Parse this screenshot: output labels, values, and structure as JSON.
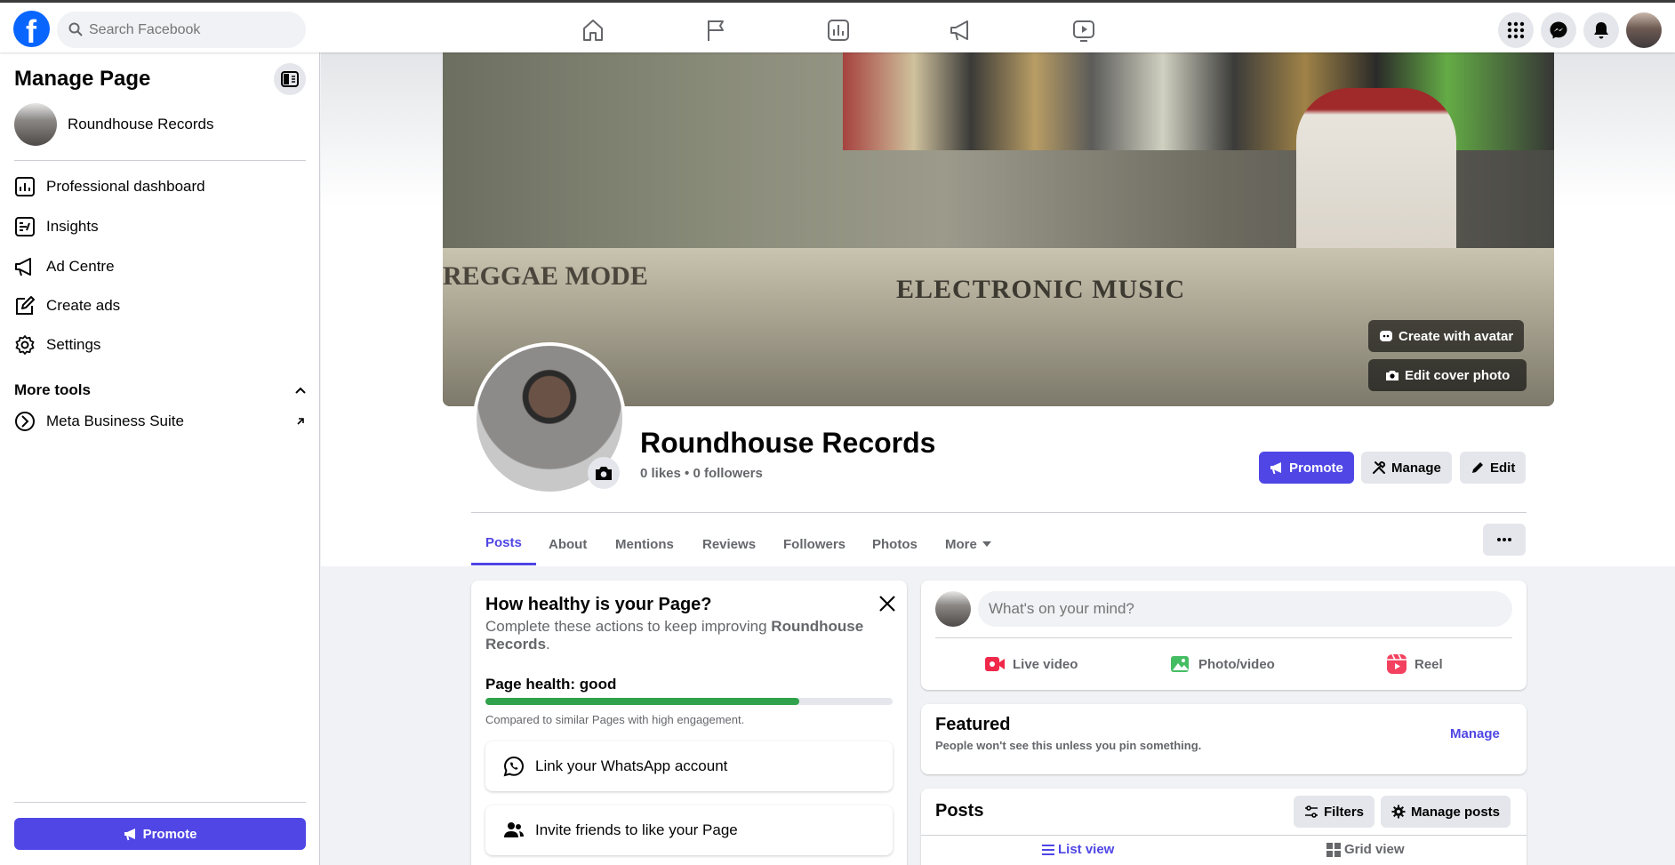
{
  "topbar": {
    "logo": "f",
    "search_placeholder": "Search Facebook",
    "nav_icons": [
      "home-icon",
      "flag-icon",
      "insights-icon",
      "megaphone-icon",
      "video-icon"
    ],
    "right_icons": [
      "menu-grid-icon",
      "messenger-icon",
      "bell-icon"
    ]
  },
  "sidebar": {
    "title": "Manage Page",
    "page_name": "Roundhouse Records",
    "items": [
      {
        "label": "Professional dashboard",
        "icon": "dashboard-icon"
      },
      {
        "label": "Insights",
        "icon": "insights-icon"
      },
      {
        "label": "Ad Centre",
        "icon": "megaphone-icon"
      },
      {
        "label": "Create ads",
        "icon": "edit-icon"
      },
      {
        "label": "Settings",
        "icon": "gear-icon"
      }
    ],
    "more_tools_label": "More tools",
    "tools": [
      {
        "label": "Meta Business Suite",
        "icon": "meta-icon"
      }
    ],
    "promote_label": "Promote"
  },
  "cover": {
    "create_avatar_label": "Create with avatar",
    "edit_cover_label": "Edit cover photo",
    "bin_label_1": "ELECTRONIC MUSIC",
    "bin_label_2": "REGGAE MODE"
  },
  "profile": {
    "name": "Roundhouse Records",
    "stats": "0 likes • 0 followers",
    "promote_label": "Promote",
    "manage_label": "Manage",
    "edit_label": "Edit"
  },
  "tabs": [
    "Posts",
    "About",
    "Mentions",
    "Reviews",
    "Followers",
    "Photos",
    "More"
  ],
  "health": {
    "title": "How healthy is your Page?",
    "desc_prefix": "Complete these actions to keep improving ",
    "desc_page": "Roundhouse Records",
    "desc_suffix": ".",
    "status": "Page health: good",
    "progress": 0.77,
    "note": "Compared to similar Pages with high engagement.",
    "actions": [
      "Link your WhatsApp account",
      "Invite friends to like your Page"
    ]
  },
  "composer": {
    "placeholder": "What's on your mind?",
    "live_label": "Live video",
    "photo_label": "Photo/video",
    "reel_label": "Reel",
    "colors": {
      "live": "#f02849",
      "photo": "#45bd62",
      "reel": "#f3425f"
    }
  },
  "featured": {
    "title": "Featured",
    "subtitle": "People won't see this unless you pin something.",
    "manage_label": "Manage"
  },
  "posts": {
    "title": "Posts",
    "filters_label": "Filters",
    "manage_label": "Manage posts",
    "list_view_label": "List view",
    "grid_view_label": "Grid view"
  },
  "colors": {
    "accent": "#4f46e5",
    "fb_blue": "#0866ff"
  }
}
